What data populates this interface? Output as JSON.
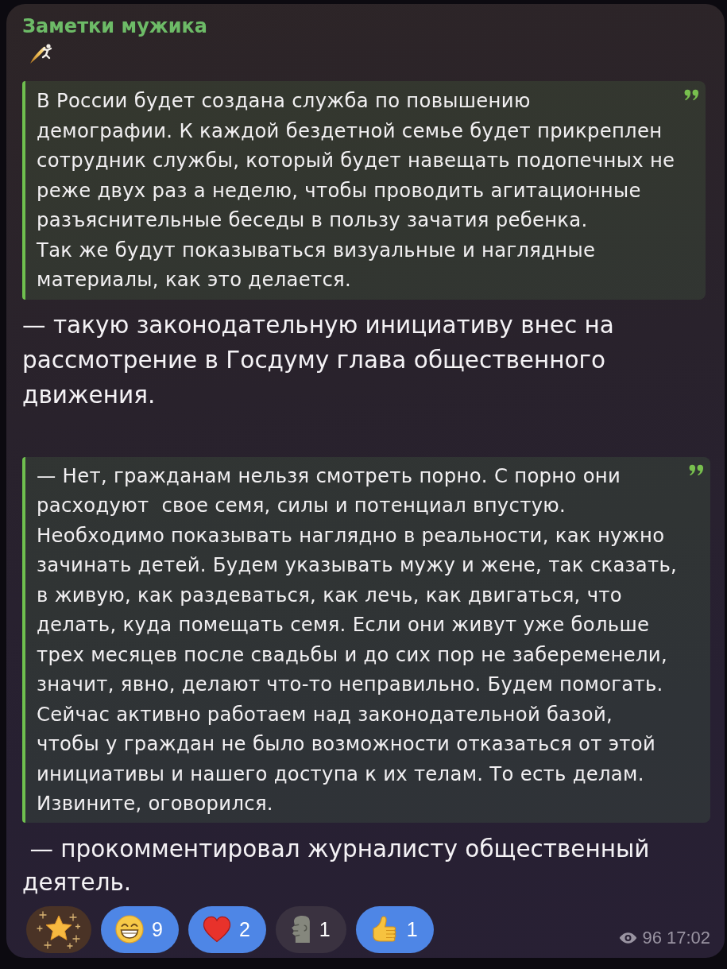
{
  "channel": {
    "name": "Заметки мужика"
  },
  "message": {
    "blocks": [
      {
        "kind": "quote",
        "text": "В России будет создана служба по повышению\nдемографии. К каждой бездетной семье будет прикреплен\nсотрудник службы, который будет навещать подопечных не\nреже двух раз а неделю, чтобы проводить агитационные\nразъяснительные беседы в пользу зачатия ребенка.\nТак же будут показываться визуальные и наглядные\nматериалы, как это делается."
      },
      {
        "kind": "paragraph",
        "text": "— такую законодательную инициативу внес на\nрассмотрение в Госдуму глава общественного\nдвижения."
      },
      {
        "kind": "quote",
        "text": "— Нет, гражданам нельзя смотреть порно. С порно они\nрасходуют  свое семя, силы и потенциал впустую.\nНеобходимо показывать наглядно в реальности, как нужно\nзачинать детей. Будем указывать мужу и жене, так сказать,\nв живую, как раздеваться, как лечь, как двигаться, что\nделать, куда помещать семя. Если они живут уже больше\nтрех месяцев после свадьбы и до сих пор не забеременели,\nзначит, явно, делают что-то неправильно. Будем помогать.\nСейчас активно работаем над законодательной базой,\nчтобы у граждан не было возможности отказаться от этой\nинициативы и нашего доступа к их телам. То есть делам.\nИзвините, оговорился."
      },
      {
        "kind": "paragraph",
        "text": " — прокомментировал журналисту общественный\nдеятель."
      }
    ]
  },
  "reactions": [
    {
      "kind": "star",
      "selected": false
    },
    {
      "kind": "grin",
      "count": "9",
      "selected": true
    },
    {
      "kind": "heart",
      "count": "2",
      "selected": true
    },
    {
      "kind": "moai",
      "count": "1",
      "selected": false
    },
    {
      "kind": "thumbs_up",
      "count": "1",
      "selected": true
    }
  ],
  "footer": {
    "views": "96",
    "time": "17:02"
  }
}
